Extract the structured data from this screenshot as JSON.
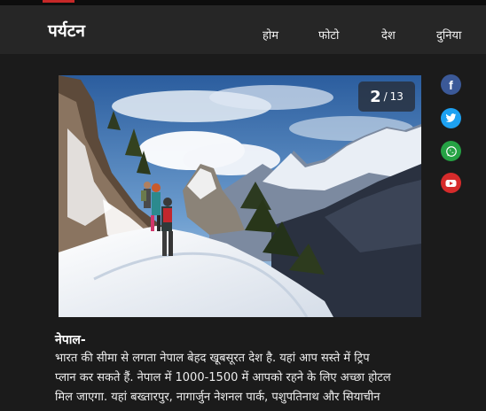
{
  "header": {
    "brand": "पर्यटन",
    "nav": [
      "होम",
      "फोटो",
      "देश",
      "दुनिया"
    ]
  },
  "slideshow": {
    "current": "2",
    "separator": "/",
    "total": "13"
  },
  "social": [
    {
      "name": "facebook-icon",
      "glyph": "f",
      "color": "#3b5998"
    },
    {
      "name": "twitter-icon",
      "glyph": "bird",
      "color": "#1da1f2"
    },
    {
      "name": "whatsapp-icon",
      "glyph": "phone",
      "color": "#25a244"
    },
    {
      "name": "youtube-icon",
      "glyph": "play",
      "color": "#d62b2b"
    }
  ],
  "caption": {
    "title": "नेपाल-",
    "lines": [
      "भारत की सीमा से लगता नेपाल बेहद खूबसूरत देश है. यहां आप सस्ते में ट्रिप",
      "प्लान कर सकते हैं. नेपाल में 1000-1500 में आपको रहने के लिए अच्छा होटल",
      "मिल जाएगा. यहां बख्तारपुर, नागार्जुन नेशनल पार्क, पशुपतिनाथ और सियाचीन"
    ]
  },
  "colors": {
    "background": "#1b1b1b",
    "header": "#262626",
    "accent": "#c62828"
  }
}
